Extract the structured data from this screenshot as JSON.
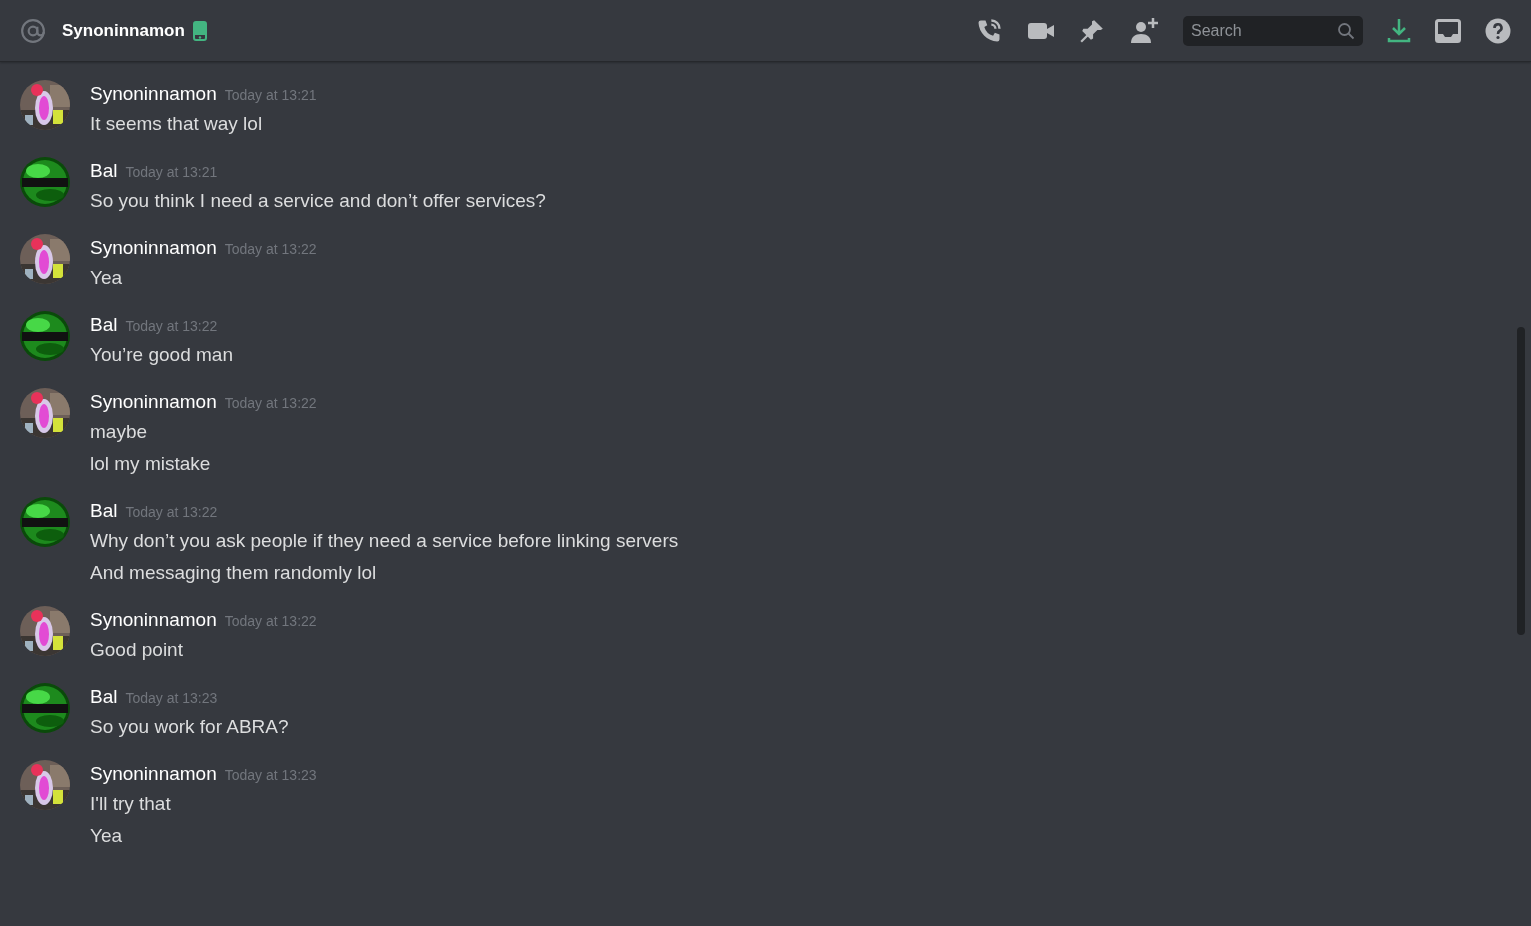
{
  "header": {
    "title": "Synoninnamon",
    "search": {
      "placeholder": "Search"
    }
  },
  "messages": [
    {
      "author": "Synoninnamon",
      "time": "Today at 13:21",
      "lines": [
        "It seems that way lol"
      ]
    },
    {
      "author": "Bal",
      "time": "Today at 13:21",
      "kind": "green",
      "lines": [
        "So you think I need a service and don’t offer services?"
      ]
    },
    {
      "author": "Synoninnamon",
      "time": "Today at 13:22",
      "lines": [
        "Yea"
      ]
    },
    {
      "author": "Bal",
      "time": "Today at 13:22",
      "kind": "green",
      "lines": [
        "You’re good man"
      ]
    },
    {
      "author": "Synoninnamon",
      "time": "Today at 13:22",
      "lines": [
        "maybe",
        "lol my mistake"
      ]
    },
    {
      "author": "Bal",
      "time": "Today at 13:22",
      "kind": "green",
      "lines": [
        "Why don’t you ask people if they need a service before linking servers",
        "And messaging them randomly lol"
      ]
    },
    {
      "author": "Synoninnamon",
      "time": "Today at 13:22",
      "lines": [
        "Good point"
      ]
    },
    {
      "author": "Bal",
      "time": "Today at 13:23",
      "kind": "green",
      "lines": [
        "So you work for ABRA?"
      ]
    },
    {
      "author": "Synoninnamon",
      "time": "Today at 13:23",
      "lines": [
        "I'll try that",
        "Yea"
      ]
    }
  ]
}
